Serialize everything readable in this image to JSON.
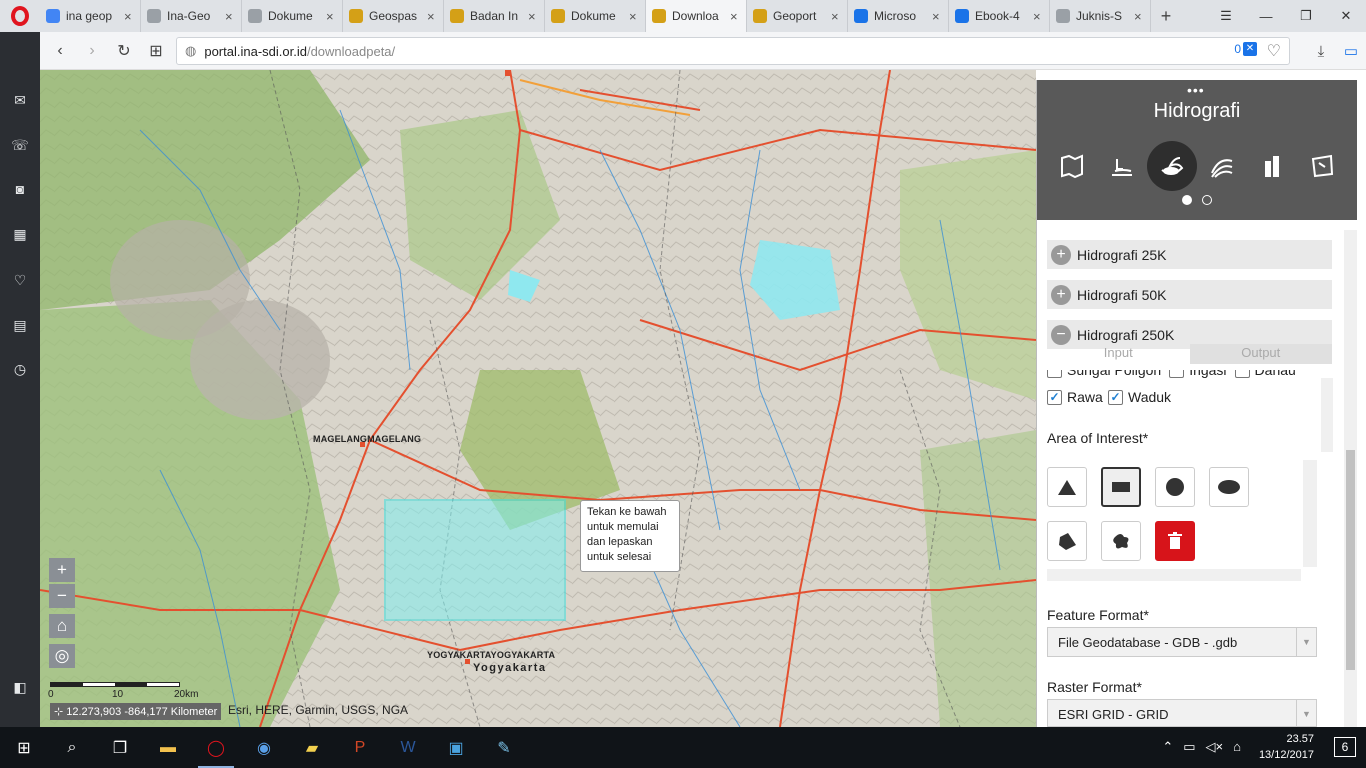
{
  "browser": {
    "tabs": [
      {
        "title": "ina geop",
        "favicon_color": "#4285f4"
      },
      {
        "title": "Ina-Geo",
        "favicon_color": "#9aa0a6"
      },
      {
        "title": "Dokume",
        "favicon_color": "#9aa0a6"
      },
      {
        "title": "Geospas",
        "favicon_color": "#d4a017"
      },
      {
        "title": "Badan In",
        "favicon_color": "#d4a017"
      },
      {
        "title": "Dokume",
        "favicon_color": "#d4a017"
      },
      {
        "title": "Downloa",
        "favicon_color": "#d4a017",
        "active": true
      },
      {
        "title": "Geoport",
        "favicon_color": "#d4a017"
      },
      {
        "title": "Microso",
        "favicon_color": "#1a73e8"
      },
      {
        "title": "Ebook-4",
        "favicon_color": "#1a73e8"
      },
      {
        "title": "Juknis-S",
        "favicon_color": "#9aa0a6"
      }
    ],
    "url_host": "portal.ina-sdi.or.id",
    "url_path": "/downloadpeta/",
    "adblock_count": "0"
  },
  "map": {
    "labels": {
      "magelang": "MAGELANGMAGELANG",
      "yogya_caps": "YOGYAKARTAYOGYAKARTA",
      "yogya": "Yogyakarta"
    },
    "tooltip": "Tekan ke bawah untuk memulai dan lepaskan untuk selesai",
    "scale": {
      "zero": "0",
      "ten": "10",
      "twenty": "20km"
    },
    "coords": "12.273,903 -864,177 Kilometer",
    "attribution": "Esri, HERE, Garmin, USGS, NGA",
    "zoom_in": "+",
    "zoom_out": "−"
  },
  "panel": {
    "dots": "•••",
    "title": "Hidrografi",
    "accordions": [
      "Hidrografi 25K",
      "Hidrografi 50K",
      "Hidrografi 250K"
    ],
    "tab_input": "Input",
    "tab_output": "Output",
    "partial_checks": [
      "Sungai Poligon",
      "Irigasi",
      "Danau"
    ],
    "checks": [
      {
        "label": "Rawa",
        "checked": true
      },
      {
        "label": "Waduk",
        "checked": true
      }
    ],
    "aoi_label": "Area of Interest*",
    "feature_format_label": "Feature Format*",
    "feature_format_value": "File Geodatabase - GDB - .gdb",
    "raster_format_label": "Raster Format*",
    "raster_format_value": "ESRI GRID - GRID"
  },
  "taskbar": {
    "time": "23.57",
    "date": "13/12/2017",
    "notifications": "6"
  },
  "colors": {
    "panel_header": "#595959",
    "delete_red": "#d7141a",
    "aoi_fill": "#7ff0f0",
    "road": "#e4502f"
  }
}
